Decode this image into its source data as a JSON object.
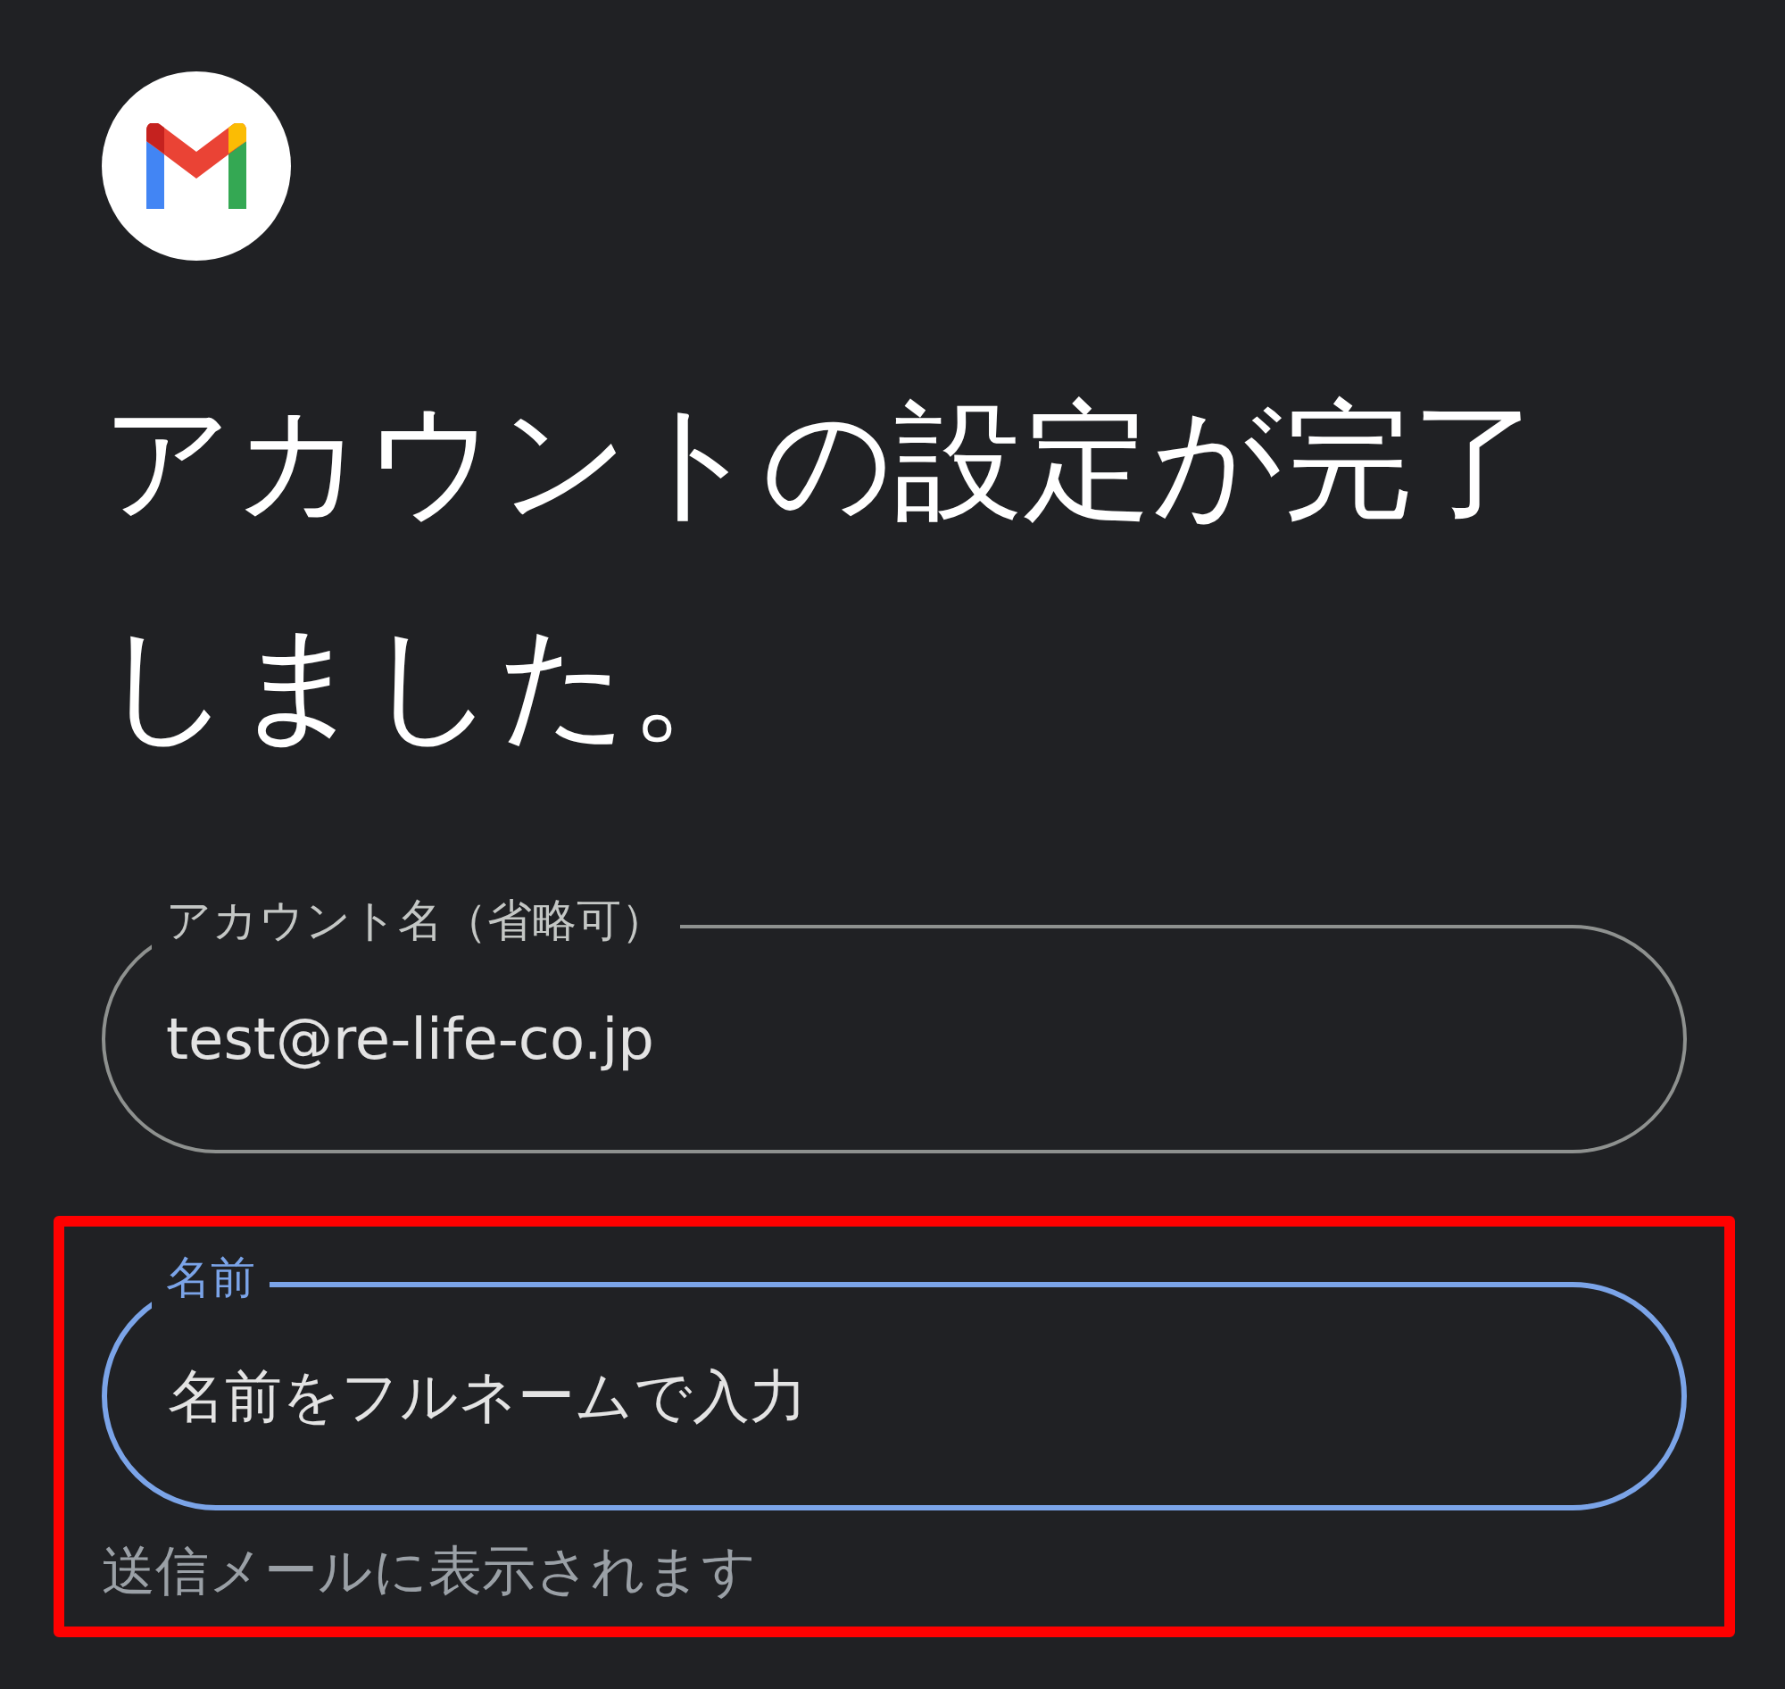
{
  "title": [
    "アカウントの設定が完了",
    "しました。"
  ],
  "fields": [
    {
      "label": "アカウント名（省略可）",
      "value": "test@re-life-co.jp",
      "focused": false,
      "highlighted": false
    },
    {
      "label": "名前",
      "placeholder": "名前をフルネームで入力",
      "helper": "送信メールに表示されます",
      "focused": true,
      "highlighted": true
    }
  ]
}
